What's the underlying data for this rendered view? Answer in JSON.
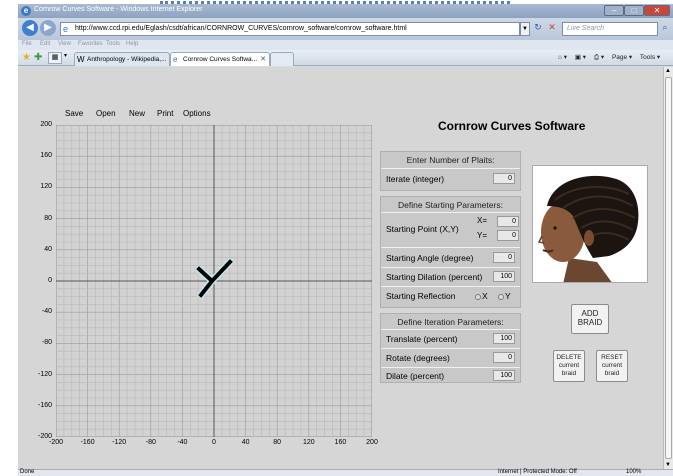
{
  "window": {
    "title": "Cornrow Curves Software - Windows Internet Explorer"
  },
  "browser": {
    "url": "http://www.ccd.rpi.edu/Eglash/csdt/african/CORNROW_CURVES/cornrow_software/cornrow_software.html",
    "search_placeholder": "Live Search",
    "menu": [
      "File",
      "Edit",
      "View",
      "Favorites",
      "Tools",
      "Help"
    ],
    "tabs": [
      {
        "label": "Anthropology - Wikipedia,..."
      },
      {
        "label": "Cornrow Curves Softwa..."
      }
    ],
    "toolbar_right": [
      "Page ▾",
      "Tools ▾"
    ],
    "status_left": "Done",
    "status_zone": "Internet | Protected Mode: Off",
    "status_zoom": "100%"
  },
  "app": {
    "menu": [
      "Save",
      "Open",
      "New",
      "Print",
      "Options"
    ],
    "title": "Cornrow Curves Software",
    "graph": {
      "x_ticks": [
        "-200",
        "-160",
        "-120",
        "-80",
        "-40",
        "0",
        "40",
        "80",
        "120",
        "160",
        "200"
      ],
      "y_ticks": [
        "200",
        "160",
        "120",
        "80",
        "40",
        "0",
        "-40",
        "-80",
        "-120",
        "-160",
        "-200"
      ],
      "range": [
        -200,
        200
      ],
      "grid_step": 10
    },
    "plaits_panel": {
      "header": "Enter Number of Plaits:",
      "iterate_label": "Iterate (integer)",
      "iterate_value": "0"
    },
    "start_panel": {
      "header": "Define Starting Parameters:",
      "point_label": "Starting Point (X,Y)",
      "x_label": "X=",
      "x_value": "0",
      "y_label": "Y=",
      "y_value": "0",
      "angle_label": "Starting Angle (degree)",
      "angle_value": "0",
      "dilation_label": "Starting Dilation (percent)",
      "dilation_value": "100",
      "reflection_label": "Starting Reflection",
      "reflection_x": "X",
      "reflection_y": "Y"
    },
    "iteration_panel": {
      "header": "Define Iteration Parameters:",
      "translate_label": "Translate (percent)",
      "translate_value": "100",
      "rotate_label": "Rotate (degrees)",
      "rotate_value": "0",
      "dilate_label": "Dilate (percent)",
      "dilate_value": "100"
    },
    "buttons": {
      "add_braid": "ADD BRAID",
      "delete": "DELETE current braid",
      "reset": "RESET current braid"
    }
  }
}
